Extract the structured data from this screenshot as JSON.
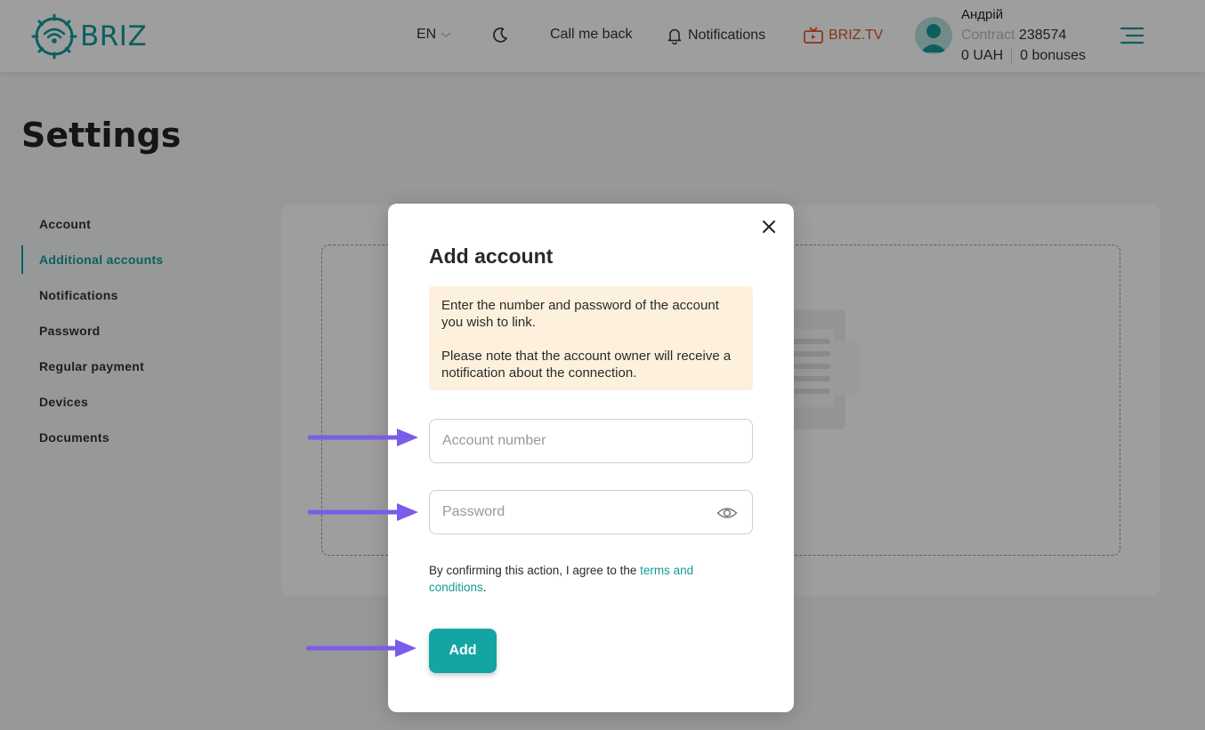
{
  "header": {
    "logo_text": "BRIZ",
    "lang": "EN",
    "call_me_back": "Call me back",
    "notifications": "Notifications",
    "tv": "BRIZ.TV",
    "user": {
      "name": "Андрій",
      "contract_label": "Contract",
      "contract_number": "238574",
      "balance": "0 UAH",
      "bonuses": "0 bonuses"
    }
  },
  "page": {
    "title": "Settings"
  },
  "sidebar": {
    "items": [
      {
        "label": "Account"
      },
      {
        "label": "Additional accounts"
      },
      {
        "label": "Notifications"
      },
      {
        "label": "Password"
      },
      {
        "label": "Regular payment"
      },
      {
        "label": "Devices"
      },
      {
        "label": "Documents"
      }
    ],
    "active_index": 1
  },
  "modal": {
    "title": "Add account",
    "info_line1": "Enter the number and password of the account you wish to link.",
    "info_line2": "Please note that the account owner will receive a notification about the connection.",
    "account_placeholder": "Account number",
    "password_placeholder": "Password",
    "terms_prefix": "By confirming this action, I agree to the ",
    "terms_link": "terms and conditions",
    "terms_suffix": ".",
    "add_label": "Add"
  },
  "colors": {
    "brand": "#149a9a",
    "tv_accent": "#e0541f",
    "info_bg": "#fdf1de",
    "arrow": "#7b5ce8"
  }
}
